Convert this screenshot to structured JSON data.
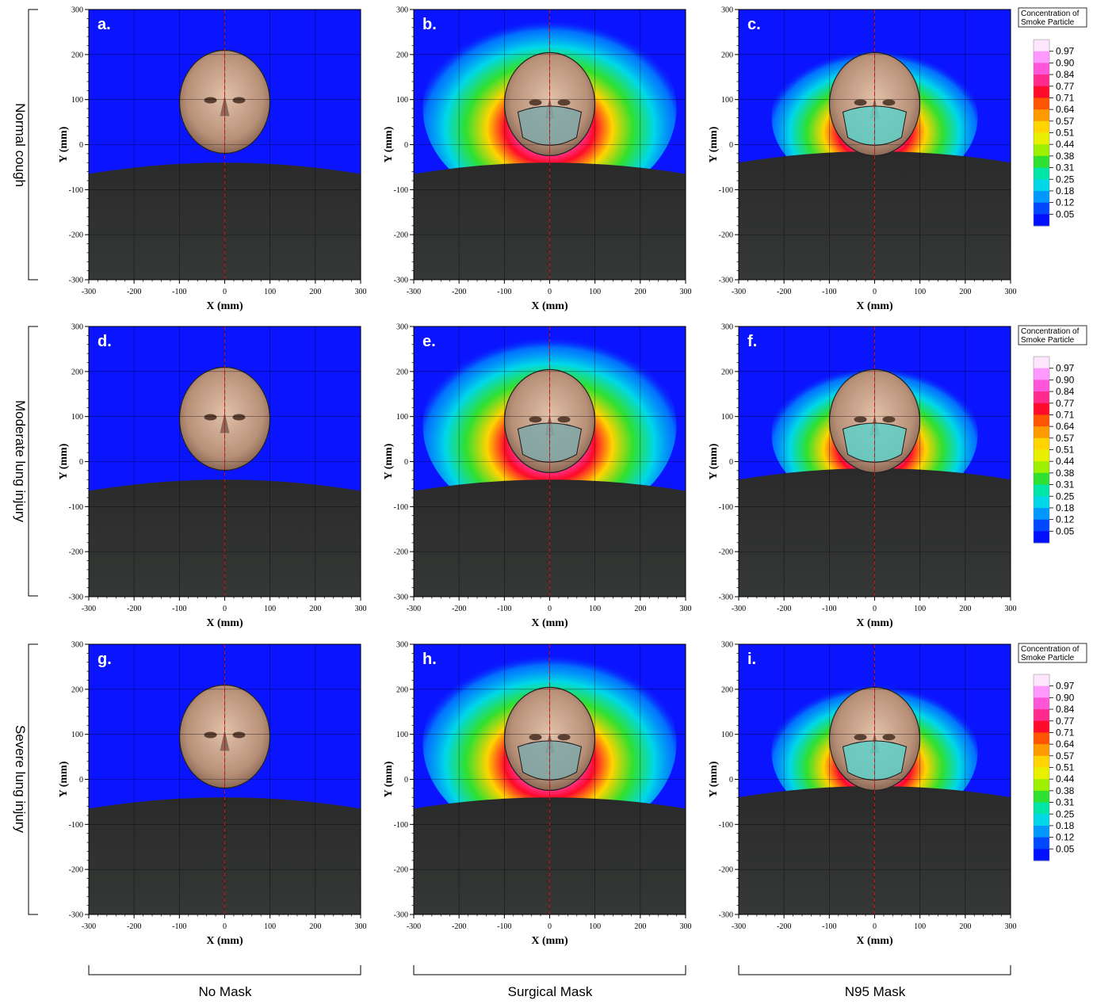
{
  "chart_data": {
    "type": "heatmap",
    "row_labels": [
      "Normal cough",
      "Moderate lung injury",
      "Severe lung injury"
    ],
    "column_labels": [
      "No Mask",
      "Surgical Mask",
      "N95 Mask"
    ],
    "xlabel": "X (mm)",
    "ylabel": "Y (mm)",
    "xlim": [
      -300,
      300
    ],
    "ylim": [
      -300,
      300
    ],
    "x_ticks": [
      "-300",
      "-200",
      "-100",
      "0",
      "100",
      "200",
      "300"
    ],
    "y_ticks": [
      "300",
      "200",
      "100",
      "0",
      "-100",
      "-200",
      "-300"
    ],
    "grid": true,
    "colorbar": {
      "title_line1": "Concentration of",
      "title_line2": "Smoke Particle",
      "levels": [
        "0.97",
        "0.90",
        "0.84",
        "0.77",
        "0.71",
        "0.64",
        "0.57",
        "0.51",
        "0.44",
        "0.38",
        "0.31",
        "0.25",
        "0.18",
        "0.12",
        "0.05"
      ],
      "colors": [
        "#ffe6ff",
        "#ff99ff",
        "#ff55d8",
        "#ff2a8c",
        "#ff0a2a",
        "#ff5500",
        "#ff9a00",
        "#ffd400",
        "#e8f000",
        "#9cf000",
        "#30e030",
        "#00e6a8",
        "#00d8e8",
        "#0098ff",
        "#0048ff",
        "#0010ff"
      ]
    },
    "panels": [
      {
        "label": "a.",
        "row": 0,
        "col": 0,
        "mask": "none",
        "plume": 0
      },
      {
        "label": "b.",
        "row": 0,
        "col": 1,
        "mask": "surgical",
        "plume": 1
      },
      {
        "label": "c.",
        "row": 0,
        "col": 2,
        "mask": "n95",
        "plume": 1
      },
      {
        "label": "d.",
        "row": 1,
        "col": 0,
        "mask": "none",
        "plume": 0
      },
      {
        "label": "e.",
        "row": 1,
        "col": 1,
        "mask": "surgical",
        "plume": 1
      },
      {
        "label": "f.",
        "row": 1,
        "col": 2,
        "mask": "n95",
        "plume": 1
      },
      {
        "label": "g.",
        "row": 2,
        "col": 0,
        "mask": "none",
        "plume": 0
      },
      {
        "label": "h.",
        "row": 2,
        "col": 1,
        "mask": "surgical",
        "plume": 1
      },
      {
        "label": "i.",
        "row": 2,
        "col": 2,
        "mask": "n95",
        "plume": 1
      }
    ],
    "background_color": "#0a14ff"
  }
}
